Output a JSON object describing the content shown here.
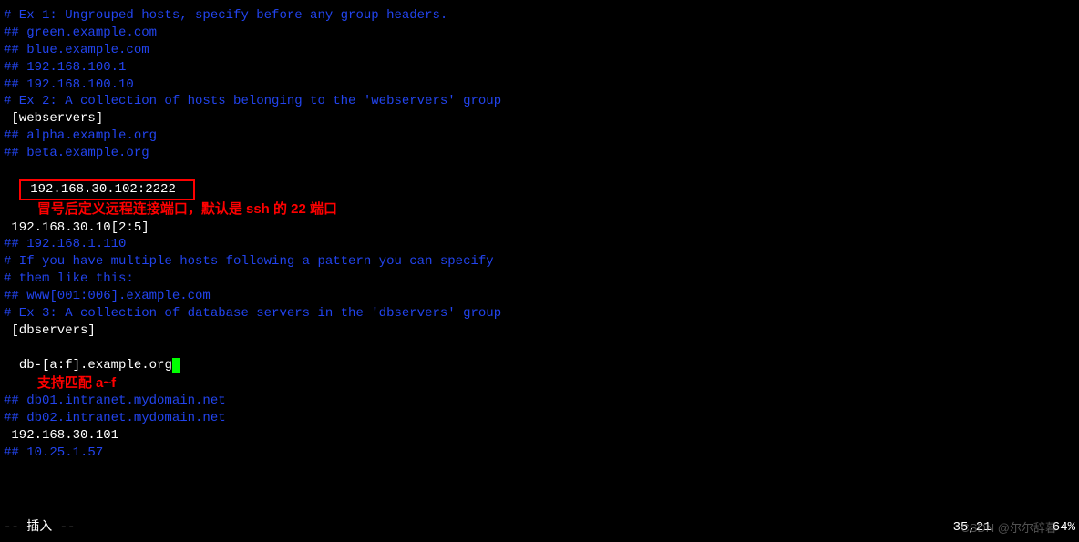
{
  "lines": {
    "ex1_header": "# Ex 1: Ungrouped hosts, specify before any group headers.",
    "blank": "",
    "green": "## green.example.com",
    "blue": "## blue.example.com",
    "ip1": "## 192.168.100.1",
    "ip2": "## 192.168.100.10",
    "ex2_header": "# Ex 2: A collection of hosts belonging to the 'webservers' group",
    "webservers": " [webservers]",
    "alpha": "## alpha.example.org",
    "beta": "## beta.example.org",
    "host_highlighted": " 192.168.30.102:2222  ",
    "annotation1": "冒号后定义远程连接端口，默认是 ssh 的 22 端口",
    "host_range": " 192.168.30.10[2:5]",
    "ip110": "## 192.168.1.110",
    "pattern1": "# If you have multiple hosts following a pattern you can specify",
    "pattern2": "# them like this:",
    "www": "## www[001:006].example.com",
    "ex3_header": "# Ex 3: A collection of database servers in the 'dbservers' group",
    "dbservers": " [dbservers]",
    "db_pattern": "db-[a:f].example.org",
    "annotation2": "支持匹配 a~f",
    "db01": "## db01.intranet.mydomain.net",
    "db02": "## db02.intranet.mydomain.net",
    "ip101": " 192.168.30.101",
    "ip1025": "## 10.25.1.57"
  },
  "status": {
    "mode": "-- 插入 --",
    "position": "35,21        64%"
  },
  "watermark": "CSDN @尔尔辞暮"
}
